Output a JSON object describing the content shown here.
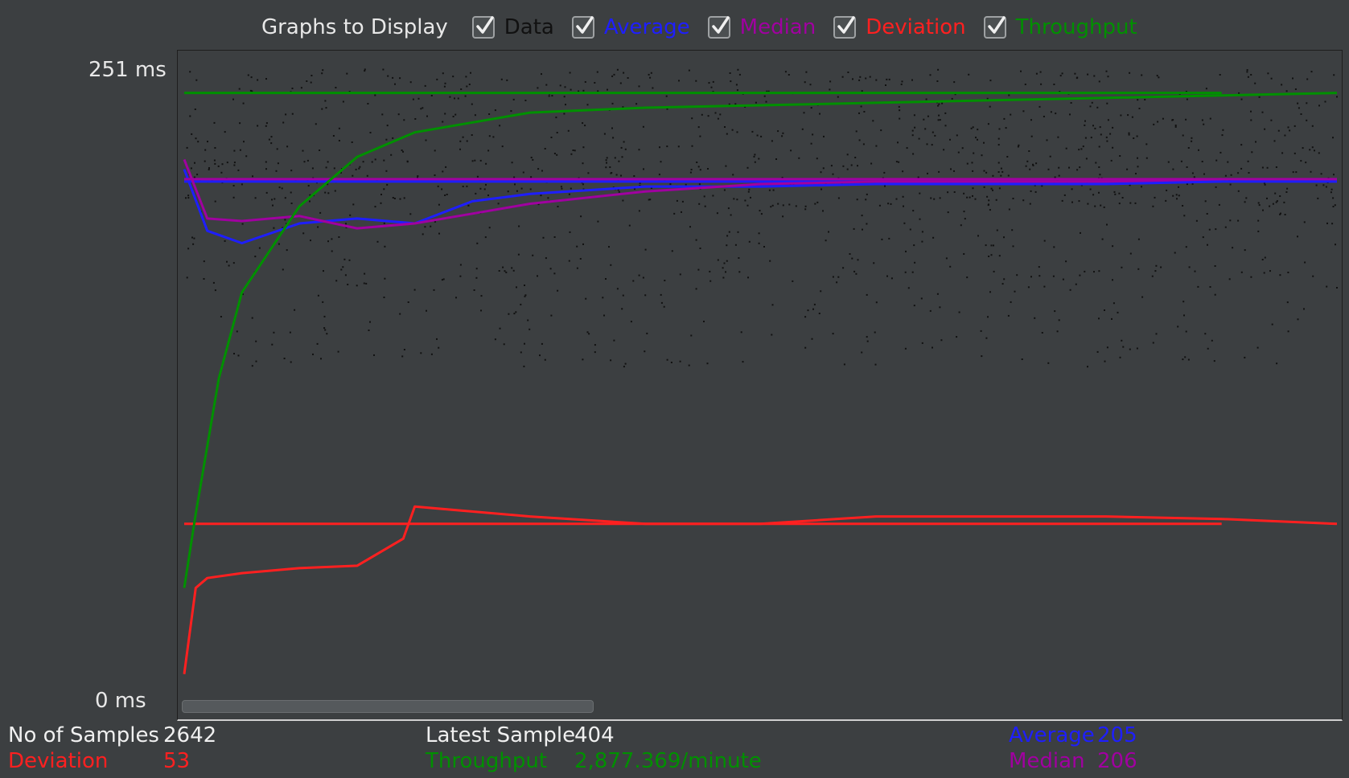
{
  "graphs_bar": {
    "title": "Graphs to Display",
    "options": [
      {
        "label": "Data",
        "checked": true,
        "color": "#111111"
      },
      {
        "label": "Average",
        "checked": true,
        "color": "#1e1eff"
      },
      {
        "label": "Median",
        "checked": true,
        "color": "#a000a0"
      },
      {
        "label": "Deviation",
        "checked": true,
        "color": "#ff2020"
      },
      {
        "label": "Throughput",
        "checked": true,
        "color": "#009000"
      }
    ]
  },
  "axis": {
    "y_max_label": "251  ms",
    "y_min_label": "0  ms"
  },
  "stats": {
    "samples_label": "No of Samples",
    "samples_value": "2642",
    "latest_label": "Latest Sample",
    "latest_value": "404",
    "average_label": "Average",
    "average_value": "205",
    "deviation_label": "Deviation",
    "deviation_value": "53",
    "throughput_label": "Throughput",
    "throughput_value": "2,877.369/minute",
    "median_label": "Median",
    "median_value": "206"
  },
  "colors": {
    "background": "#3c3f41",
    "data": "#111111",
    "average": "#1e1eff",
    "median": "#a000a0",
    "deviation": "#ff2020",
    "throughput": "#009000"
  },
  "chart_data": {
    "type": "scatter",
    "ylim": [
      0,
      251
    ],
    "series": [
      {
        "name": "Data",
        "description": "scatter of response times",
        "count": 2642
      },
      {
        "name": "Average",
        "x": [
          0,
          0.02,
          0.05,
          0.1,
          0.15,
          0.2,
          0.25,
          0.3,
          0.4,
          0.5,
          0.6,
          0.7,
          0.8,
          0.9,
          1.0
        ],
        "values": [
          210,
          185,
          180,
          188,
          190,
          188,
          197,
          200,
          203,
          203,
          204,
          204,
          204,
          205,
          205
        ]
      },
      {
        "name": "Median",
        "x": [
          0,
          0.02,
          0.05,
          0.1,
          0.15,
          0.2,
          0.25,
          0.3,
          0.4,
          0.5,
          0.6,
          0.7,
          0.8,
          0.9,
          1.0
        ],
        "values": [
          214,
          190,
          189,
          191,
          186,
          188,
          192,
          196,
          201,
          204,
          205,
          205,
          205,
          206,
          206
        ]
      },
      {
        "name": "Deviation",
        "x": [
          0,
          0.01,
          0.02,
          0.05,
          0.1,
          0.15,
          0.19,
          0.2,
          0.3,
          0.4,
          0.5,
          0.6,
          0.7,
          0.8,
          0.9,
          1.0
        ],
        "values": [
          5,
          40,
          44,
          46,
          48,
          49,
          60,
          73,
          69,
          66,
          66,
          69,
          69,
          69,
          68,
          66
        ]
      },
      {
        "name": "Throughput",
        "x": [
          0,
          0.01,
          0.03,
          0.05,
          0.1,
          0.15,
          0.2,
          0.3,
          0.4,
          0.5,
          0.6,
          0.7,
          0.8,
          0.9,
          1.0
        ],
        "values": [
          40,
          70,
          125,
          160,
          195,
          215,
          225,
          233,
          235,
          236,
          237,
          238,
          239,
          240,
          241
        ]
      }
    ]
  }
}
